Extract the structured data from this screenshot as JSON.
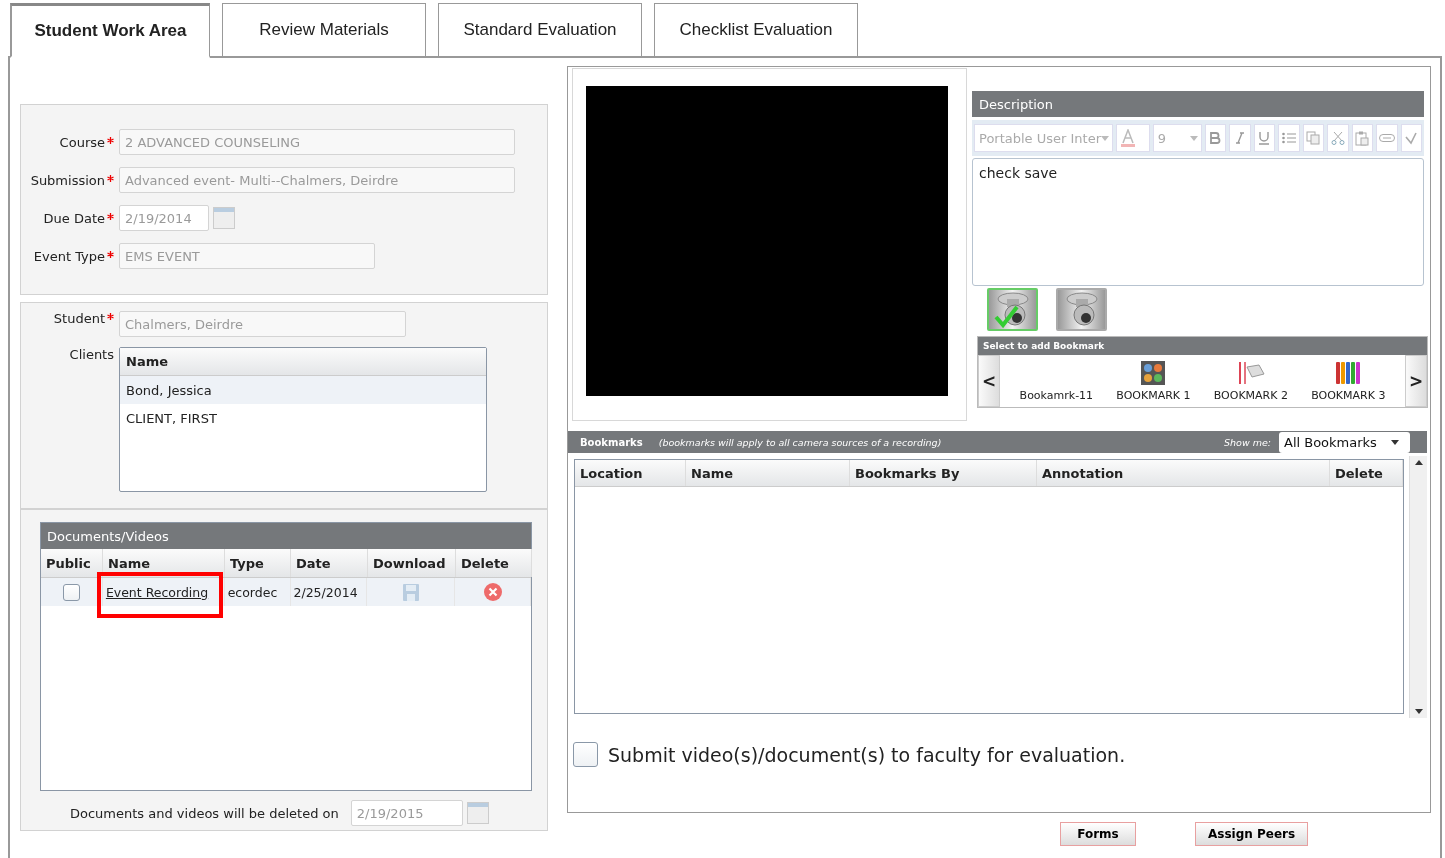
{
  "tabs": [
    {
      "label": "Student Work Area",
      "selected": true
    },
    {
      "label": "Review Materials",
      "selected": false
    },
    {
      "label": "Standard Evaluation",
      "selected": false
    },
    {
      "label": "Checklist Evaluation",
      "selected": false
    }
  ],
  "submission_form": {
    "fields": [
      {
        "label": "Course",
        "required": true,
        "value": "2 ADVANCED COUNSELING",
        "kind": "text"
      },
      {
        "label": "Submission",
        "required": true,
        "value": "Advanced event- Multi--Chalmers, Deirdre",
        "kind": "text"
      },
      {
        "label": "Due Date",
        "required": true,
        "value": "2/19/2014",
        "kind": "date"
      },
      {
        "label": "Event Type",
        "required": true,
        "value": "EMS EVENT",
        "kind": "short"
      }
    ]
  },
  "student": {
    "label": "Student",
    "required": true,
    "value": "Chalmers, Deirdre"
  },
  "clients": {
    "label": "Clients",
    "column": "Name",
    "rows": [
      {
        "name": "Bond, Jessica",
        "selected": true
      },
      {
        "name": "CLIENT, FIRST",
        "selected": false
      }
    ]
  },
  "documents": {
    "title": "Documents/Videos",
    "columns": [
      "Public",
      "Name",
      "Type",
      "Date",
      "Download",
      "Delete"
    ],
    "rows": [
      {
        "public": false,
        "name": "Event Recording",
        "type": "ecordec",
        "date": "2/25/2014",
        "highlighted": true
      }
    ],
    "deletion_note": {
      "label": "Documents and videos will be deleted on",
      "value": "2/19/2015"
    }
  },
  "video": {
    "kind": "blank"
  },
  "description": {
    "title": "Description",
    "font": "Portable User Inter",
    "size": "9",
    "text": "check save"
  },
  "cameras": [
    {
      "selected": true
    },
    {
      "selected": false
    }
  ],
  "bookmark_picker": {
    "title": "Select to add Bookmark",
    "prev": "<",
    "next": ">",
    "items": [
      {
        "label": "Bookamrk-11",
        "kind": "plain"
      },
      {
        "label": "BOOKMARK 1",
        "kind": "grid"
      },
      {
        "label": "BOOKMARK 2",
        "kind": "flag"
      },
      {
        "label": "BOOKMARK 3",
        "kind": "stripes"
      }
    ]
  },
  "bookmarks": {
    "title": "Bookmarks",
    "note": "(bookmarks will apply to all camera sources of a recording)",
    "filter_label": "Show me:",
    "filter_value": "All Bookmarks",
    "columns": [
      "Location",
      "Name",
      "Bookmarks By",
      "Annotation",
      "Delete"
    ]
  },
  "submit": {
    "checked": false,
    "label": "Submit video(s)/document(s) to faculty for evaluation."
  },
  "buttons": [
    "Forms",
    "Assign Peers"
  ]
}
